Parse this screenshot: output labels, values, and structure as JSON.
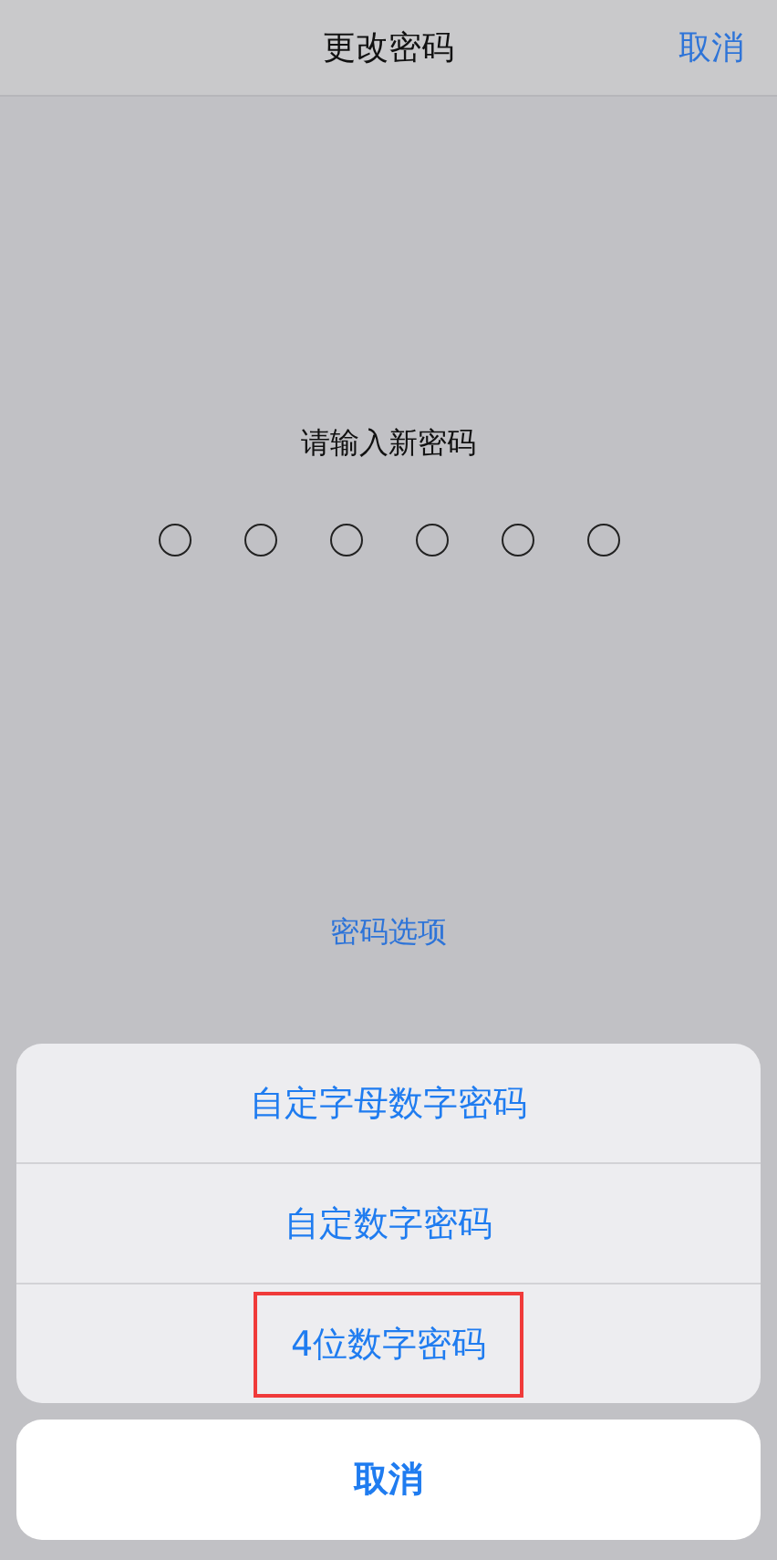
{
  "nav_bar": {
    "title": "更改密码",
    "cancel": "取消"
  },
  "prompt": "请输入新密码",
  "pin_dots": [
    {
      "filled": false
    },
    {
      "filled": false
    },
    {
      "filled": false
    },
    {
      "filled": false
    },
    {
      "filled": false
    },
    {
      "filled": false
    }
  ],
  "options_link": "密码选项",
  "action_sheet": {
    "options": [
      {
        "label": "自定字母数字密码",
        "highlighted": false
      },
      {
        "label": "自定数字密码",
        "highlighted": false
      },
      {
        "label": "4位数字密码",
        "highlighted": true
      }
    ],
    "cancel": "取消"
  }
}
